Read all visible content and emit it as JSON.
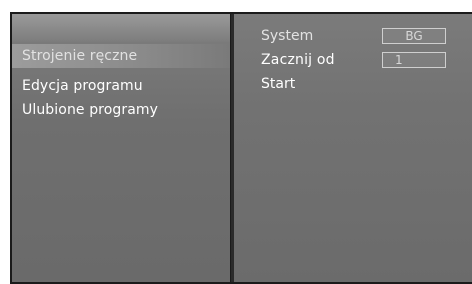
{
  "menu": {
    "items": [
      {
        "label": "Strojenie ręczne",
        "active": true
      },
      {
        "label": "Edycja programu",
        "active": false
      },
      {
        "label": "Ulubione programy",
        "active": false
      }
    ]
  },
  "settings": {
    "system": {
      "label": "System",
      "value": "BG"
    },
    "start_from": {
      "label": "Zacznij od",
      "value": "1"
    },
    "start": {
      "label": "Start"
    }
  }
}
